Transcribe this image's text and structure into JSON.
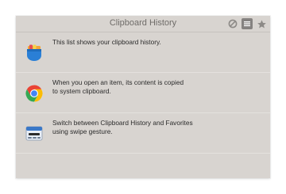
{
  "window": {
    "title": "Clipboard History"
  },
  "toolbar": {
    "icons": [
      "block-icon",
      "list-icon",
      "star-icon"
    ]
  },
  "colors": {
    "panel_background": "#d8d4d0",
    "title_text": "#6f6c69",
    "active_control": "#858280"
  },
  "items": [
    {
      "text": "This list shows your clipboard history.",
      "icon": "pocket-icon"
    },
    {
      "text": "When you open an item, its content is copied\nto system clipboard.",
      "icon": "chrome-icon"
    },
    {
      "text": "Switch between Clipboard History and Favorites\nusing swipe gesture.",
      "icon": "swipe-app-icon"
    }
  ]
}
